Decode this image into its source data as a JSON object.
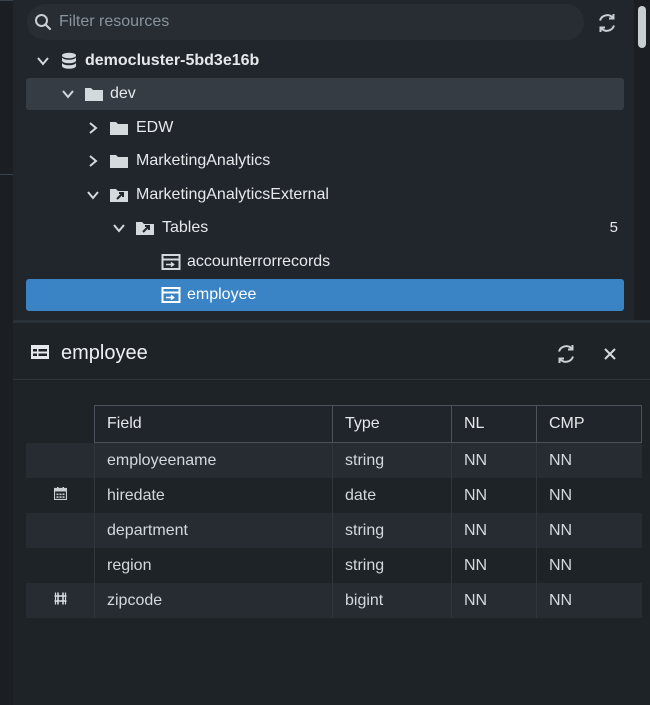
{
  "search": {
    "placeholder": "Filter resources",
    "value": ""
  },
  "tree": {
    "cluster": {
      "label": "democluster-5bd3e16b",
      "icon": "database-icon",
      "expanded": true
    },
    "db": {
      "label": "dev",
      "icon": "folder-icon",
      "expanded": true
    },
    "schemas": [
      {
        "label": "EDW",
        "icon": "folder-icon",
        "expanded": false
      },
      {
        "label": "MarketingAnalytics",
        "icon": "folder-icon",
        "expanded": false
      },
      {
        "label": "MarketingAnalyticsExternal",
        "icon": "external-folder-icon",
        "expanded": true
      }
    ],
    "tables_node": {
      "label": "Tables",
      "count": "5",
      "icon": "external-folder-icon",
      "expanded": true
    },
    "tables": [
      {
        "label": "accounterrorrecords",
        "icon": "external-table-icon",
        "selected": false
      },
      {
        "label": "employee",
        "icon": "external-table-icon",
        "selected": true
      }
    ]
  },
  "details": {
    "title": "employee",
    "columns": [
      "Field",
      "Type",
      "NL",
      "CMP"
    ],
    "rows": [
      {
        "icon": "",
        "field": "employeename",
        "type": "string",
        "nl": "NN",
        "cmp": "NN"
      },
      {
        "icon": "calendar-icon",
        "field": "hiredate",
        "type": "date",
        "nl": "NN",
        "cmp": "NN"
      },
      {
        "icon": "",
        "field": "department",
        "type": "string",
        "nl": "NN",
        "cmp": "NN"
      },
      {
        "icon": "",
        "field": "region",
        "type": "string",
        "nl": "NN",
        "cmp": "NN"
      },
      {
        "icon": "number-grid-icon",
        "field": "zipcode",
        "type": "bigint",
        "nl": "NN",
        "cmp": "NN"
      }
    ]
  },
  "colors": {
    "selected": "#3a84c5",
    "hover": "#353c44",
    "background": "#20252b"
  }
}
